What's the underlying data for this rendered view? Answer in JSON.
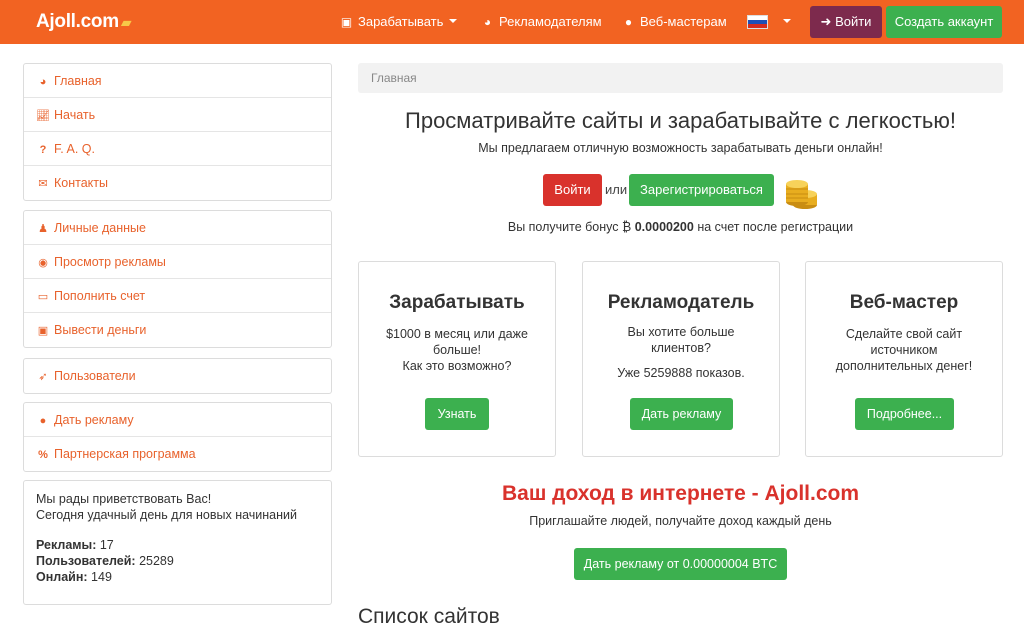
{
  "colors": {
    "navbar": "#f26322",
    "accent": "#e8622c",
    "green": "#3cb04f",
    "red": "#d9322c",
    "login_top": "#7d2a4d"
  },
  "navbar": {
    "brand": "Ajoll.com",
    "links": [
      {
        "label": "Зарабатывать",
        "icon": "money-icon",
        "dropdown": true
      },
      {
        "label": "Рекламодателям",
        "icon": "dashboard-icon"
      },
      {
        "label": "Веб-мастерам",
        "icon": "globe-icon"
      }
    ],
    "language_icon": "russian-flag-icon",
    "login": "Войти",
    "signup": "Создать аккаунт"
  },
  "sidebar": {
    "group1": [
      {
        "label": "Главная",
        "icon": "dashboard-icon"
      },
      {
        "label": "Начать",
        "icon": "chart-icon"
      },
      {
        "label": "F. A. Q.",
        "icon": "question-icon"
      },
      {
        "label": "Контакты",
        "icon": "envelope-icon"
      }
    ],
    "group2": [
      {
        "label": "Личные данные",
        "icon": "user-icon"
      },
      {
        "label": "Просмотр рекламы",
        "icon": "eye-icon"
      },
      {
        "label": "Пополнить счет",
        "icon": "credit-card-icon"
      },
      {
        "label": "Вывести деньги",
        "icon": "money-icon"
      }
    ],
    "group3": [
      {
        "label": "Пользователи",
        "icon": "rocket-icon"
      }
    ],
    "group4": [
      {
        "label": "Дать рекламу",
        "icon": "globe-icon"
      },
      {
        "label": "Партнерская программа",
        "icon": "percent-icon"
      }
    ],
    "welcome": {
      "line1": "Мы рады приветствовать Вас!",
      "line2": "Сегодня удачный день для новых начинаний",
      "ads_label": "Рекламы:",
      "ads_value": "17",
      "users_label": "Пользователей:",
      "users_value": "25289",
      "online_label": "Онлайн:",
      "online_value": "149"
    }
  },
  "main": {
    "breadcrumb": "Главная",
    "hero_title": "Просматривайте сайты и зарабатывайте с легкостью!",
    "hero_subtitle": "Мы предлагаем отличную возможность зарабатывать деньги онлайн!",
    "login_button": "Войти",
    "or": "или",
    "register_button": "Зарегистрироваться",
    "bonus_prefix": "Вы получите бонус ₿",
    "bonus_amount": "0.0000200",
    "bonus_suffix": "на счет после регистрации",
    "cards": [
      {
        "title": "Зарабатывать",
        "text": "$1000 в месяц или даже больше!",
        "text2": "Как это возможно?",
        "button": "Узнать"
      },
      {
        "title": "Рекламодатель",
        "text": "Вы хотите больше клиентов?",
        "text2": "Уже 5259888 показов.",
        "button": "Дать рекламу"
      },
      {
        "title": "Веб-мастер",
        "text": "Сделайте свой сайт источником дополнительных денег!",
        "text2": "",
        "button": "Подробнее..."
      }
    ],
    "income_title": "Ваш доход в интернете - Ajoll.com",
    "income_subtitle": "Приглашайте людей, получайте доход каждый день",
    "ad_button": "Дать рекламу от 0.00000004 BTC",
    "sites_title": "Список сайтов"
  }
}
